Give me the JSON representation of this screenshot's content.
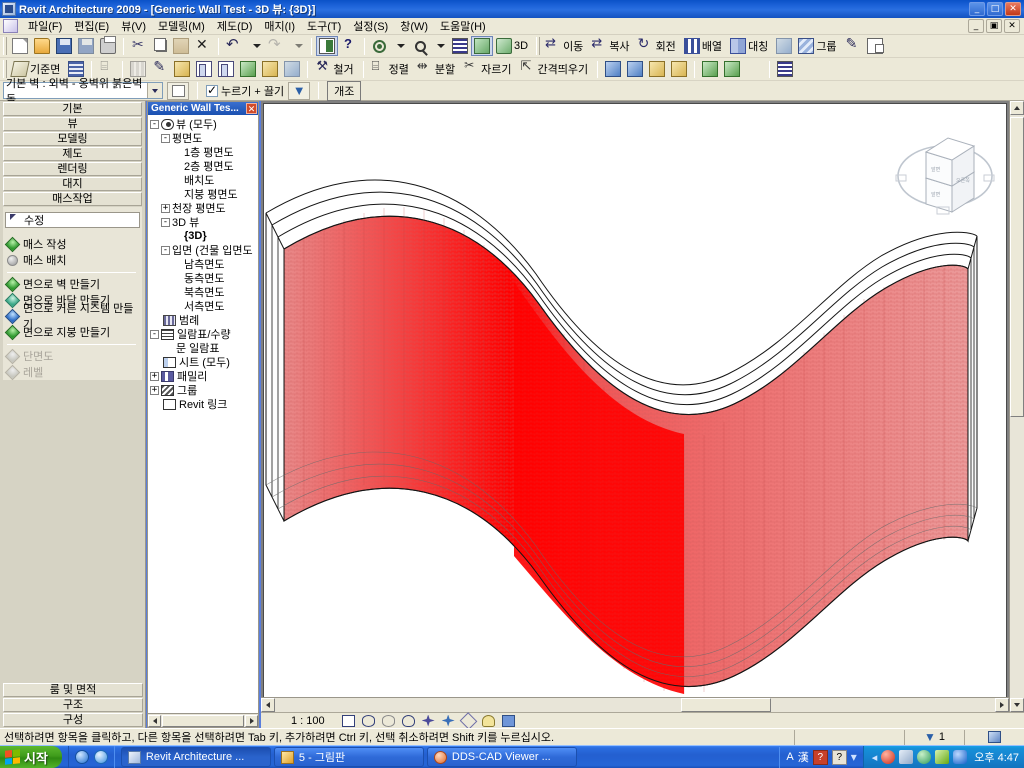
{
  "window": {
    "title": "Revit Architecture 2009 - [Generic Wall Test - 3D 뷰: {3D}]",
    "minimize": "_",
    "maximize": "□",
    "close": "✕",
    "doc_minimize": "_",
    "doc_restore": "▣",
    "doc_close": "✕"
  },
  "menubar": {
    "items": [
      {
        "label": "파일(F)"
      },
      {
        "label": "편집(E)"
      },
      {
        "label": "뷰(V)"
      },
      {
        "label": "모델링(M)"
      },
      {
        "label": "제도(D)"
      },
      {
        "label": "매지(I)"
      },
      {
        "label": "도구(T)"
      },
      {
        "label": "설정(S)"
      },
      {
        "label": "창(W)"
      },
      {
        "label": "도움말(H)"
      }
    ]
  },
  "toolbar_row1": {
    "items": [
      {
        "name": "new-file",
        "icon": "doc",
        "label": ""
      },
      {
        "name": "open-file",
        "icon": "folder",
        "label": ""
      },
      {
        "name": "save-file",
        "icon": "save",
        "label": ""
      },
      {
        "name": "save-as",
        "icon": "print",
        "label": ""
      },
      {
        "name": "print",
        "icon": "print",
        "label": ""
      },
      {
        "name": "cut",
        "icon": "cut",
        "label": ""
      },
      {
        "name": "copy",
        "icon": "copy",
        "label": ""
      },
      {
        "name": "paste",
        "icon": "paste",
        "label": ""
      },
      {
        "name": "delete",
        "icon": "xred",
        "label": ""
      },
      {
        "name": "undo",
        "icon": "undo",
        "label": ""
      },
      {
        "name": "undo-dropdown",
        "icon": "drop",
        "label": ""
      },
      {
        "name": "redo",
        "icon": "redo",
        "label": ""
      },
      {
        "name": "redo-dropdown",
        "icon": "drop",
        "label": ""
      },
      {
        "name": "match-properties",
        "icon": "match",
        "label": ""
      },
      {
        "name": "context-help",
        "icon": "help",
        "label": ""
      },
      {
        "name": "zoom-region",
        "icon": "disc",
        "label": ""
      },
      {
        "name": "zoom-dropdown",
        "icon": "drop",
        "label": ""
      },
      {
        "name": "zoom-in",
        "icon": "zoom",
        "label": ""
      },
      {
        "name": "zoom-list-dropdown",
        "icon": "drop",
        "label": ""
      },
      {
        "name": "thin-lines",
        "icon": "bars",
        "label": ""
      },
      {
        "name": "default-3d-view",
        "icon": "cube3d",
        "label": ""
      },
      {
        "name": "camera-view",
        "icon": "house",
        "label": "3D"
      }
    ],
    "edit_tools": [
      {
        "name": "move-tool",
        "icon": "move",
        "label": "이동"
      },
      {
        "name": "copy-tool",
        "icon": "move",
        "label": "복사"
      },
      {
        "name": "rotate-tool",
        "icon": "rot",
        "label": "회전"
      },
      {
        "name": "array-tool",
        "icon": "arr",
        "label": "배열"
      },
      {
        "name": "mirror-tool",
        "icon": "mir",
        "label": "대칭"
      },
      {
        "name": "scale-tool",
        "icon": "blue",
        "label": ""
      },
      {
        "name": "group-tool",
        "icon": "grp",
        "label": "그룹"
      },
      {
        "name": "pin-tool",
        "icon": "pen",
        "label": ""
      },
      {
        "name": "link-tool",
        "icon": "link",
        "label": ""
      }
    ]
  },
  "toolbar_row2": {
    "items": [
      {
        "name": "work-plane",
        "icon": "plane",
        "label": "기준면"
      },
      {
        "name": "grid-tool",
        "icon": "grid",
        "label": ""
      },
      {
        "name": "check-tool",
        "icon": "align",
        "label": ""
      },
      {
        "name": "level-tool",
        "icon": "wall",
        "label": ""
      },
      {
        "name": "paint-tool",
        "icon": "pen",
        "label": ""
      },
      {
        "name": "split-face",
        "icon": "yel",
        "label": ""
      },
      {
        "name": "wall-tool",
        "icon": "door",
        "label": ""
      },
      {
        "name": "door-tool",
        "icon": "door",
        "label": ""
      },
      {
        "name": "fill-tool",
        "icon": "green",
        "label": ""
      },
      {
        "name": "component-tool",
        "icon": "yel",
        "label": ""
      },
      {
        "name": "room-tool",
        "icon": "blue",
        "label": ""
      },
      {
        "name": "demolish-tool",
        "icon": "demo",
        "label": "철거"
      },
      {
        "name": "align-tool",
        "icon": "align",
        "label": "정렬"
      },
      {
        "name": "split-tool",
        "icon": "split",
        "label": "분할"
      },
      {
        "name": "trim-tool",
        "icon": "trim",
        "label": "자르기"
      },
      {
        "name": "offset-tool",
        "icon": "offs",
        "label": "간격띄우기"
      },
      {
        "name": "copy-clip",
        "icon": "blue",
        "label": ""
      },
      {
        "name": "paste-aligned",
        "icon": "blue",
        "label": ""
      },
      {
        "name": "create-similar",
        "icon": "yel",
        "label": ""
      },
      {
        "name": "element-props",
        "icon": "yel",
        "label": ""
      },
      {
        "name": "crop-region",
        "icon": "green",
        "label": ""
      },
      {
        "name": "hide-element",
        "icon": "green",
        "label": ""
      },
      {
        "name": "reveal-hidden",
        "icon": "dim",
        "label": ""
      },
      {
        "name": "chart-tool",
        "icon": "bars",
        "label": ""
      }
    ]
  },
  "options_bar": {
    "type_selector_value": "기본 벽 : 외벽 - 옹벽위 붉은벽돌",
    "properties_button": "properties-icon",
    "press_drag_label": "누르기 + 끌기",
    "press_drag_checked": true,
    "filter_button": "filter-icon",
    "remodel_button": "개조"
  },
  "design_bar": {
    "tabs": [
      {
        "label": "기본"
      },
      {
        "label": "뷰"
      },
      {
        "label": "모델링"
      },
      {
        "label": "제도"
      },
      {
        "label": "렌더링"
      },
      {
        "label": "대지"
      },
      {
        "label": "매스작업"
      }
    ],
    "selected_tool": "수정",
    "groups": [
      {
        "items": [
          {
            "label": "매스 작성",
            "icon": "gem-g",
            "disabled": false
          },
          {
            "label": "매스 배치",
            "icon": "gem-gray",
            "disabled": false
          }
        ]
      },
      {
        "items": [
          {
            "label": "면으로 벽 만들기",
            "icon": "gem-g",
            "disabled": false
          },
          {
            "label": "면으로 바닥 만들기",
            "icon": "gem-teal",
            "disabled": false
          },
          {
            "label": "면으로 커튼 시스템 만들기",
            "icon": "gem-b",
            "disabled": false
          },
          {
            "label": "면으로 지붕 만들기",
            "icon": "gem-g",
            "disabled": false
          }
        ]
      },
      {
        "items": [
          {
            "label": "단면도",
            "icon": "gem-dim",
            "disabled": true
          },
          {
            "label": "레벨",
            "icon": "gem-dim",
            "disabled": true
          }
        ]
      }
    ],
    "bottom_tabs": [
      {
        "label": "룸 및 면적"
      },
      {
        "label": "구조"
      },
      {
        "label": "구성"
      }
    ]
  },
  "project_browser": {
    "title": "Generic Wall Tes...",
    "close": "✕",
    "tree": [
      {
        "label": "뷰 (모두)",
        "indent": 0,
        "expander": "-",
        "icon": "eye",
        "bold": false
      },
      {
        "label": "평면도",
        "indent": 1,
        "expander": "-",
        "icon": "",
        "bold": false
      },
      {
        "label": "1층 평면도",
        "indent": 2,
        "expander": "",
        "icon": "",
        "bold": false
      },
      {
        "label": "2층 평면도",
        "indent": 2,
        "expander": "",
        "icon": "",
        "bold": false
      },
      {
        "label": "배치도",
        "indent": 2,
        "expander": "",
        "icon": "",
        "bold": false
      },
      {
        "label": "지붕 평면도",
        "indent": 2,
        "expander": "",
        "icon": "",
        "bold": false
      },
      {
        "label": "천장 평면도",
        "indent": 1,
        "expander": "+",
        "icon": "",
        "bold": false
      },
      {
        "label": "3D 뷰",
        "indent": 1,
        "expander": "-",
        "icon": "",
        "bold": false
      },
      {
        "label": "{3D}",
        "indent": 2,
        "expander": "",
        "icon": "",
        "bold": true
      },
      {
        "label": "입면 (건물 입면도",
        "indent": 1,
        "expander": "-",
        "icon": "",
        "bold": false
      },
      {
        "label": "남측면도",
        "indent": 2,
        "expander": "",
        "icon": "",
        "bold": false
      },
      {
        "label": "동측면도",
        "indent": 2,
        "expander": "",
        "icon": "",
        "bold": false
      },
      {
        "label": "북측면도",
        "indent": 2,
        "expander": "",
        "icon": "",
        "bold": false
      },
      {
        "label": "서측면도",
        "indent": 2,
        "expander": "",
        "icon": "",
        "bold": false
      },
      {
        "label": "범례",
        "indent": 0,
        "expander": "",
        "icon": "ti-legend",
        "bold": false
      },
      {
        "label": "일람표/수량",
        "indent": 0,
        "expander": "-",
        "icon": "ti-sched",
        "bold": false
      },
      {
        "label": "문 일람표",
        "indent": 1,
        "expander": "",
        "icon": "",
        "bold": false
      },
      {
        "label": "시트 (모두)",
        "indent": 0,
        "expander": "",
        "icon": "ti-sheet",
        "bold": false
      },
      {
        "label": "패밀리",
        "indent": 0,
        "expander": "+",
        "icon": "ti-fam",
        "bold": false
      },
      {
        "label": "그룹",
        "indent": 0,
        "expander": "+",
        "icon": "ti-grp",
        "bold": false
      },
      {
        "label": "Revit 링크",
        "indent": 0,
        "expander": "",
        "icon": "ti-link",
        "bold": false
      }
    ]
  },
  "viewport": {
    "scale": "1 : 100",
    "view_controls": [
      {
        "name": "scale-control",
        "glyph": "▣"
      },
      {
        "name": "detail-level-control",
        "glyph": "⬭"
      },
      {
        "name": "model-graphics-control",
        "glyph": "◗"
      },
      {
        "name": "shadows-control",
        "glyph": "◔"
      },
      {
        "name": "render-control",
        "glyph": "✦"
      },
      {
        "name": "crop-view-control",
        "glyph": "✥"
      },
      {
        "name": "show-crop-control",
        "glyph": "⬡"
      },
      {
        "name": "temporary-hide-control",
        "glyph": "Ὂ1"
      },
      {
        "name": "reveal-hidden-control",
        "glyph": "◀"
      }
    ],
    "model_colors": {
      "wall_face_red": "#ee1111",
      "wall_hatch_red": "#e26060",
      "wall_outline": "#1a1a1a",
      "background": "#ffffff"
    },
    "view_cube_labels": [
      "앞면",
      "오른쪽",
      "위"
    ]
  },
  "status_bar": {
    "message": "선택하려면 항목을 클릭하고, 다른 항목을 선택하려면 Tab 키, 추가하려면 Ctrl 키, 선택 취소하려면 Shift 키를 누르십시오.",
    "filter_count": "1",
    "worksets_icon": "worksets-icon"
  },
  "taskbar": {
    "start_label": "시작",
    "quick_launch": [
      {
        "name": "internet-explorer-icon"
      },
      {
        "name": "browser-icon"
      }
    ],
    "tasks": [
      {
        "label": "Revit Architecture ...",
        "icon": "ti-revit",
        "active": true
      },
      {
        "label": "5 - 그림판",
        "icon": "ti-paint",
        "active": false
      },
      {
        "label": "DDS-CAD Viewer ...",
        "icon": "ti-dds",
        "active": false
      }
    ],
    "language_indicator": "A",
    "ime_indicator": "漢",
    "tray_time": "오후 4:47",
    "tray_icons": [
      {
        "name": "show-hidden-icons-icon"
      },
      {
        "name": "antivirus-icon"
      },
      {
        "name": "network-icon"
      },
      {
        "name": "sync-icon"
      },
      {
        "name": "nvidia-icon"
      },
      {
        "name": "bluetooth-icon"
      }
    ]
  }
}
